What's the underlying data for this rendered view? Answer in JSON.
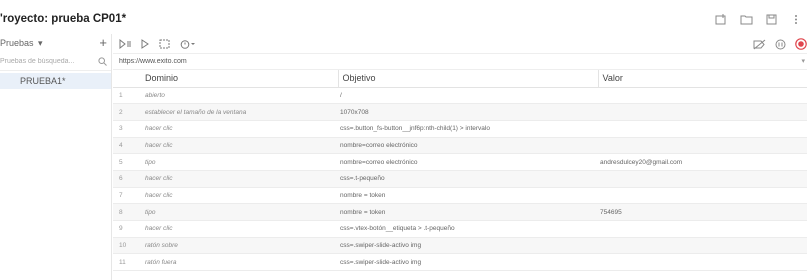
{
  "project": {
    "title": "'royecto: prueba CP01*"
  },
  "left_panel": {
    "suites_label": "Pruebas",
    "add_label": "+",
    "search_placeholder": "Pruebas de búsqueda...",
    "tests": [
      {
        "label": "PRUEBA1*"
      }
    ]
  },
  "url_bar": {
    "value": "https://www.exito.com",
    "caret": "▾"
  },
  "table": {
    "headers": {
      "command": "Dominio",
      "target": "Objetivo",
      "value": "Valor"
    },
    "rows": [
      {
        "num": "1",
        "command": "abierto",
        "target": "/",
        "value": ""
      },
      {
        "num": "2",
        "command": "establecer el tamaño de la ventana",
        "target": "1070x708",
        "value": ""
      },
      {
        "num": "3",
        "command": "hacer clic",
        "target": "css=.button_fs-button__jnf6p:nth-child(1) > intervalo",
        "value": ""
      },
      {
        "num": "4",
        "command": "hacer clic",
        "target": "nombre=correo electrónico",
        "value": ""
      },
      {
        "num": "5",
        "command": "tipo",
        "target": "nombre=correo electrónico",
        "value": "andresdulcey20@gmail.com"
      },
      {
        "num": "6",
        "command": "hacer clic",
        "target": "css=.t-pequeño",
        "value": ""
      },
      {
        "num": "7",
        "command": "hacer clic",
        "target": "nombre = token",
        "value": ""
      },
      {
        "num": "8",
        "command": "tipo",
        "target": "nombre = token",
        "value": "754695"
      },
      {
        "num": "9",
        "command": "hacer clic",
        "target": "css=.vtex-botón__etiqueta > .t-pequeño",
        "value": ""
      },
      {
        "num": "10",
        "command": "ratón sobre",
        "target": "css=.swiper-slide-activo img",
        "value": ""
      },
      {
        "num": "11",
        "command": "ratón fuera",
        "target": "css=.swiper-slide-activo img",
        "value": ""
      }
    ]
  },
  "colors": {
    "selected_test_bg": "#e9f0f9",
    "record_red": "#e0464e",
    "icon_gray": "#7a7a7a"
  }
}
